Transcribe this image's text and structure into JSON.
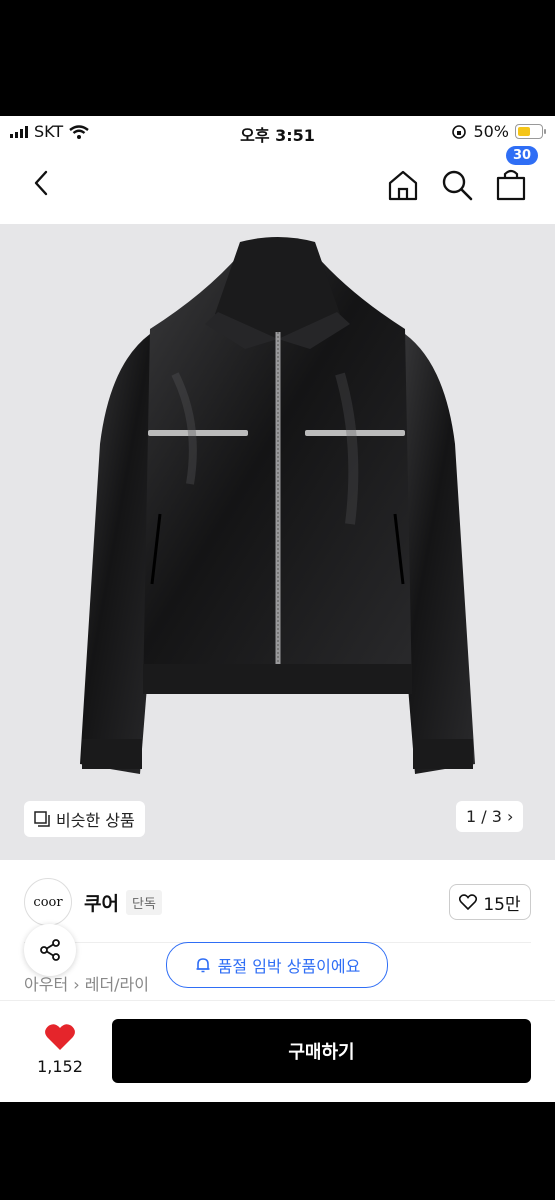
{
  "status_bar": {
    "carrier": "SKT",
    "time": "오후 3:51",
    "battery": "50%"
  },
  "header": {
    "cart_count": "30",
    "icons": [
      "back-icon",
      "home-icon",
      "search-icon",
      "bag-icon"
    ]
  },
  "gallery": {
    "similar_label": "비슷한 상품",
    "pager": "1 / 3 ›"
  },
  "brand": {
    "logo_text": "coor",
    "name": "쿠어",
    "tag": "단독",
    "likes": "15만"
  },
  "breadcrumb": "아우터 › 레더/라이",
  "toast": "품절 임박 상품이에요",
  "bottom_bar": {
    "heart_count": "1,152",
    "buy_label": "구매하기"
  },
  "colors": {
    "accent": "#2f6ef5",
    "heart": "#e5252b",
    "buy_bg": "#000000",
    "battery": "#f5c518"
  }
}
